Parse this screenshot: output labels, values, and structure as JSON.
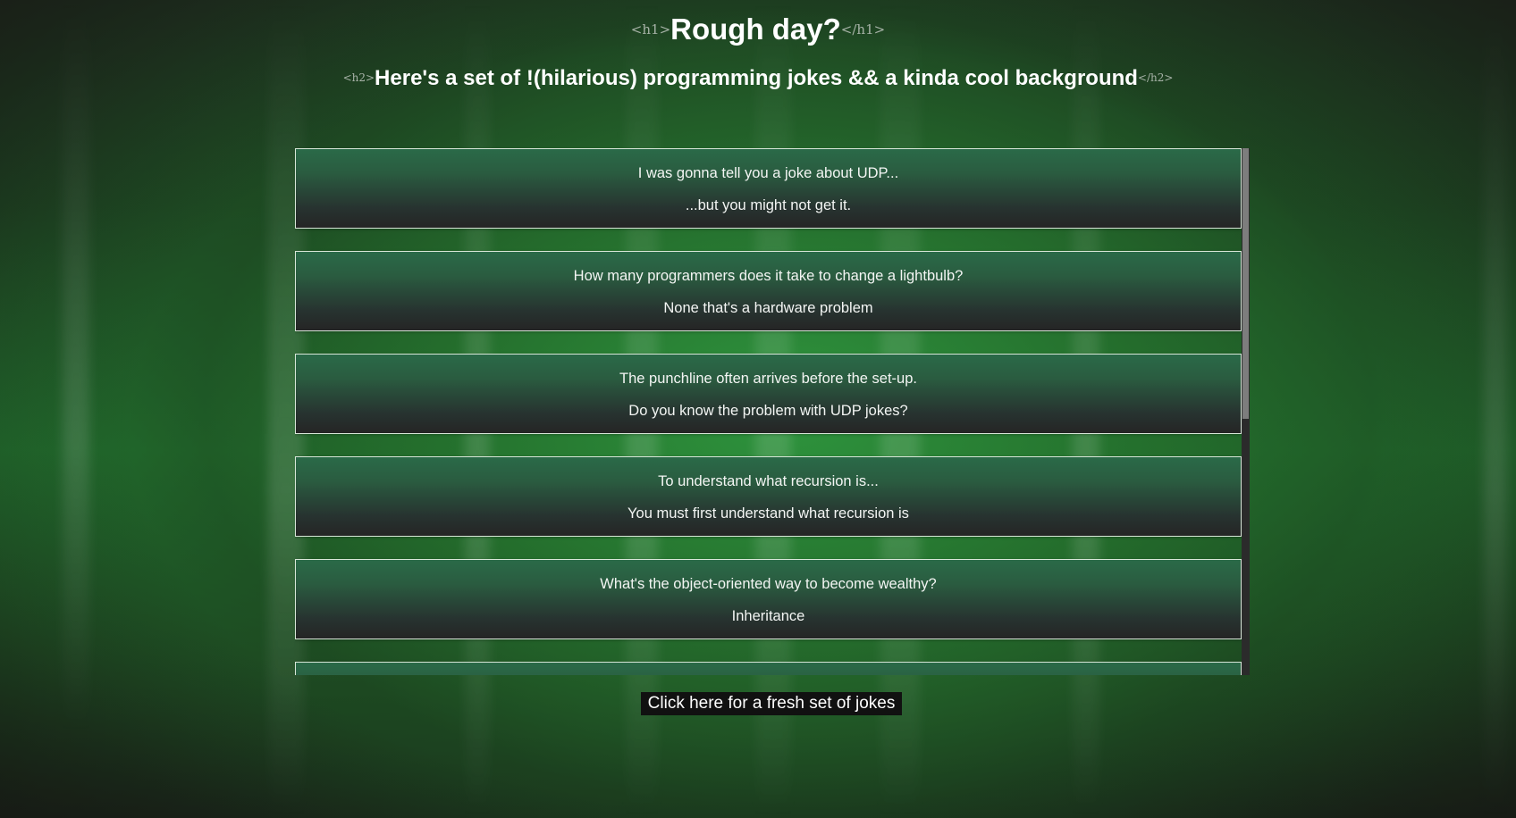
{
  "header": {
    "h1_open_tag": "<h1>",
    "title": "Rough day?",
    "h1_close_tag": "</h1>",
    "h2_open_tag": "<h2>",
    "subtitle": "Here's a set of !(hilarious) programming jokes && a kinda cool background",
    "h2_close_tag": "</h2>"
  },
  "jokes": [
    {
      "setup": "I was gonna tell you a joke about UDP...",
      "punchline": "...but you might not get it."
    },
    {
      "setup": "How many programmers does it take to change a lightbulb?",
      "punchline": "None that's a hardware problem"
    },
    {
      "setup": "The punchline often arrives before the set-up.",
      "punchline": "Do you know the problem with UDP jokes?"
    },
    {
      "setup": "To understand what recursion is...",
      "punchline": "You must first understand what recursion is"
    },
    {
      "setup": "What's the object-oriented way to become wealthy?",
      "punchline": "Inheritance"
    },
    {
      "setup": "",
      "punchline": ""
    }
  ],
  "refresh_button": {
    "label": "Click here for a fresh set of jokes"
  },
  "colors": {
    "background_green": "#2f963e",
    "card_top": "#2a6a48",
    "card_bottom": "#252525",
    "button_bg": "#111111",
    "scroll_thumb": "#7d7d7d"
  }
}
